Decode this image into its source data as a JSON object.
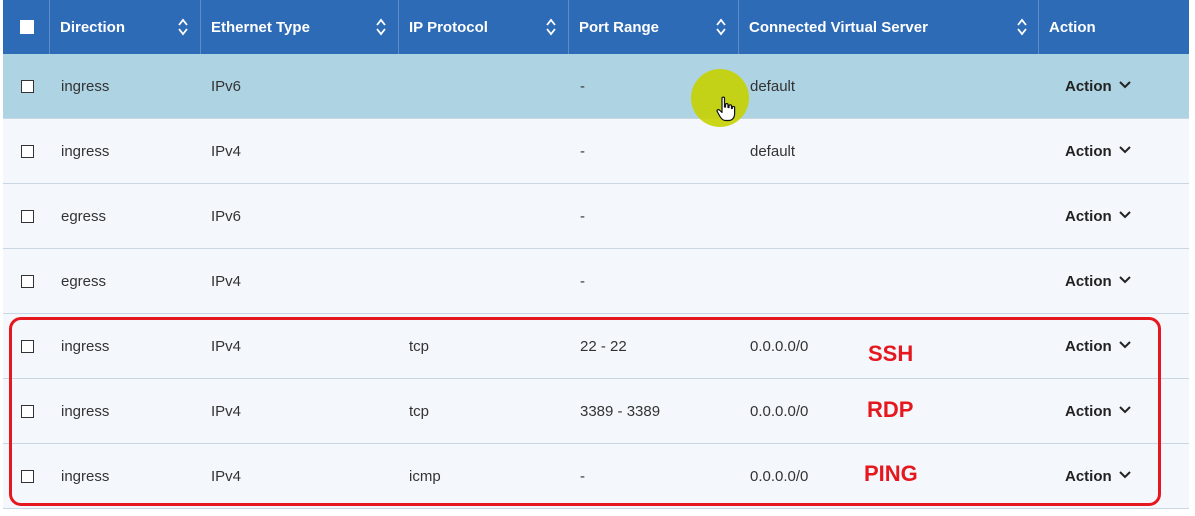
{
  "table": {
    "columns": [
      {
        "label": "Direction"
      },
      {
        "label": "Ethernet Type"
      },
      {
        "label": "IP Protocol"
      },
      {
        "label": "Port Range"
      },
      {
        "label": "Connected Virtual Server"
      },
      {
        "label": "Action"
      }
    ],
    "rows": [
      {
        "direction": "ingress",
        "ethernet_type": "IPv6",
        "ip_protocol": "",
        "port_range": "-",
        "connected_virtual_server": "default",
        "action": "Action"
      },
      {
        "direction": "ingress",
        "ethernet_type": "IPv4",
        "ip_protocol": "",
        "port_range": "-",
        "connected_virtual_server": "default",
        "action": "Action"
      },
      {
        "direction": "egress",
        "ethernet_type": "IPv6",
        "ip_protocol": "",
        "port_range": "-",
        "connected_virtual_server": "",
        "action": "Action"
      },
      {
        "direction": "egress",
        "ethernet_type": "IPv4",
        "ip_protocol": "",
        "port_range": "-",
        "connected_virtual_server": "",
        "action": "Action"
      },
      {
        "direction": "ingress",
        "ethernet_type": "IPv4",
        "ip_protocol": "tcp",
        "port_range": "22 - 22",
        "connected_virtual_server": "0.0.0.0/0",
        "action": "Action"
      },
      {
        "direction": "ingress",
        "ethernet_type": "IPv4",
        "ip_protocol": "tcp",
        "port_range": "3389 - 3389",
        "connected_virtual_server": "0.0.0.0/0",
        "action": "Action"
      },
      {
        "direction": "ingress",
        "ethernet_type": "IPv4",
        "ip_protocol": "icmp",
        "port_range": "-",
        "connected_virtual_server": "0.0.0.0/0",
        "action": "Action"
      }
    ]
  },
  "annotations": {
    "ssh": "SSH",
    "rdp": "RDP",
    "ping": "PING"
  },
  "colors": {
    "header_bg": "#2d6bb6",
    "row_bg": "#f4f8fc",
    "highlight_row_bg": "#aed3e3",
    "annotation_red": "#e5171f",
    "cursor_highlight": "#c6d200"
  },
  "icons": {
    "sort": "sort-updown-icon",
    "action_menu": "chevron-down-icon",
    "cursor": "hand-pointer-icon"
  }
}
